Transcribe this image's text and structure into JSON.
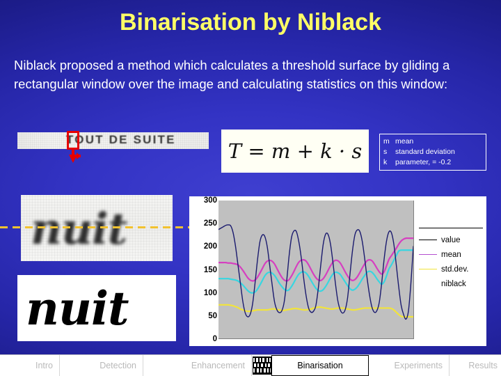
{
  "slide": {
    "title": "Binarisation by Niblack",
    "body": "Niblack proposed a method which calculates a threshold surface by gliding a rectangular window over the image and calculating statistics on this window:",
    "formula": "T = m + k · s",
    "background_color": "#2626a8",
    "title_color": "#ffff66"
  },
  "symbols": [
    {
      "symbol": "m",
      "meaning": "mean"
    },
    {
      "symbol": "s",
      "meaning": "standard deviation"
    },
    {
      "symbol": "k",
      "meaning": "parameter, = -0.2"
    }
  ],
  "samples": {
    "line_image_text": "TOUT DE SUITE",
    "gray_word": "nuit",
    "binary_word": "nuit"
  },
  "chart_data": {
    "type": "line",
    "title": "",
    "xlabel": "",
    "ylabel": "",
    "ylim": [
      0,
      300
    ],
    "yticks": [
      300,
      250,
      200,
      150,
      100,
      50,
      0
    ],
    "grid": false,
    "legend_position": "right",
    "x": [
      0,
      1,
      2,
      3,
      4,
      5,
      6,
      7,
      8,
      9,
      10,
      11,
      12,
      13,
      14,
      15,
      16,
      17,
      18,
      19,
      20,
      21,
      22,
      23,
      24,
      25,
      26,
      27,
      28,
      29,
      30,
      31,
      32,
      33,
      34,
      35,
      36,
      37,
      38,
      39,
      40,
      41,
      42,
      43,
      44,
      45,
      46,
      47,
      48,
      49,
      50,
      51,
      52,
      53,
      54,
      55,
      56,
      57,
      58,
      59,
      60,
      61,
      62,
      63,
      64,
      65,
      66,
      67,
      68,
      69,
      70,
      71,
      72,
      73,
      74,
      75,
      76,
      77,
      78,
      79,
      80
    ],
    "series": [
      {
        "name": "value",
        "color": "#1a1a6e",
        "values": [
          237,
          240,
          243,
          246,
          247,
          245,
          230,
          200,
          160,
          120,
          80,
          55,
          47,
          52,
          75,
          120,
          170,
          210,
          225,
          222,
          200,
          160,
          118,
          80,
          62,
          56,
          60,
          80,
          125,
          180,
          220,
          234,
          232,
          210,
          175,
          130,
          92,
          66,
          57,
          59,
          72,
          110,
          160,
          205,
          227,
          226,
          205,
          165,
          120,
          82,
          62,
          55,
          62,
          88,
          140,
          190,
          225,
          236,
          233,
          212,
          175,
          132,
          95,
          68,
          57,
          60,
          78,
          120,
          172,
          212,
          232,
          230,
          205,
          160,
          112,
          72,
          52,
          42,
          60,
          120,
          200
        ]
      },
      {
        "name": "mean",
        "color": "#d63fc0",
        "values": [
          165,
          165,
          165,
          165,
          164,
          164,
          163,
          162,
          160,
          155,
          148,
          140,
          132,
          127,
          125,
          127,
          133,
          142,
          152,
          162,
          168,
          170,
          168,
          162,
          152,
          142,
          133,
          127,
          125,
          128,
          136,
          146,
          157,
          166,
          170,
          171,
          168,
          160,
          150,
          140,
          132,
          127,
          126,
          130,
          138,
          148,
          158,
          166,
          170,
          169,
          164,
          155,
          145,
          136,
          129,
          126,
          128,
          134,
          143,
          153,
          162,
          169,
          171,
          169,
          162,
          153,
          145,
          140,
          145,
          158,
          172,
          180,
          188,
          196,
          205,
          212,
          216,
          218,
          218,
          218,
          218
        ]
      },
      {
        "name": "std.dev.",
        "color": "#f2e43a",
        "values": [
          73,
          73,
          73,
          73,
          73,
          72,
          71,
          69,
          67,
          64,
          62,
          60,
          59,
          59,
          60,
          61,
          62,
          62,
          62,
          62,
          62,
          63,
          64,
          64,
          63,
          62,
          61,
          61,
          62,
          63,
          64,
          65,
          65,
          64,
          63,
          62,
          62,
          63,
          64,
          66,
          67,
          68,
          68,
          67,
          66,
          65,
          64,
          64,
          65,
          66,
          66,
          66,
          65,
          64,
          63,
          62,
          62,
          63,
          64,
          65,
          66,
          66,
          66,
          66,
          66,
          66,
          66,
          66,
          66,
          66,
          66,
          65,
          62,
          57,
          52,
          48,
          47,
          47,
          47,
          47,
          47
        ]
      },
      {
        "name": "niblack",
        "color": "#38d6e0",
        "values": [
          130,
          130,
          130,
          130,
          130,
          129,
          128,
          127,
          125,
          121,
          116,
          110,
          104,
          100,
          99,
          101,
          107,
          116,
          126,
          136,
          142,
          144,
          142,
          137,
          129,
          120,
          113,
          107,
          104,
          106,
          113,
          122,
          132,
          140,
          144,
          145,
          142,
          135,
          126,
          117,
          109,
          104,
          103,
          106,
          113,
          122,
          132,
          140,
          144,
          143,
          139,
          131,
          123,
          115,
          108,
          105,
          107,
          112,
          120,
          129,
          137,
          144,
          146,
          144,
          138,
          130,
          123,
          118,
          123,
          136,
          151,
          160,
          170,
          180,
          190,
          192,
          192,
          192,
          192,
          192,
          192
        ]
      }
    ]
  },
  "legend": [
    {
      "label": "value",
      "color": "#000000",
      "has_swatch": true
    },
    {
      "label": "mean",
      "color": "#b44fd0",
      "has_swatch": true
    },
    {
      "label": "std.dev.",
      "color": "#f2e43a",
      "has_swatch": true
    },
    {
      "label": "niblack",
      "color": "#ffffff",
      "has_swatch": false
    }
  ],
  "navbar": {
    "items": [
      {
        "label": "Intro",
        "active": false
      },
      {
        "label": "Detection",
        "active": false
      },
      {
        "label": "Enhancement",
        "active": false
      },
      {
        "label": "Binarisation",
        "active": true
      },
      {
        "label": "Experiments",
        "active": false
      },
      {
        "label": "Results",
        "active": false
      }
    ]
  }
}
